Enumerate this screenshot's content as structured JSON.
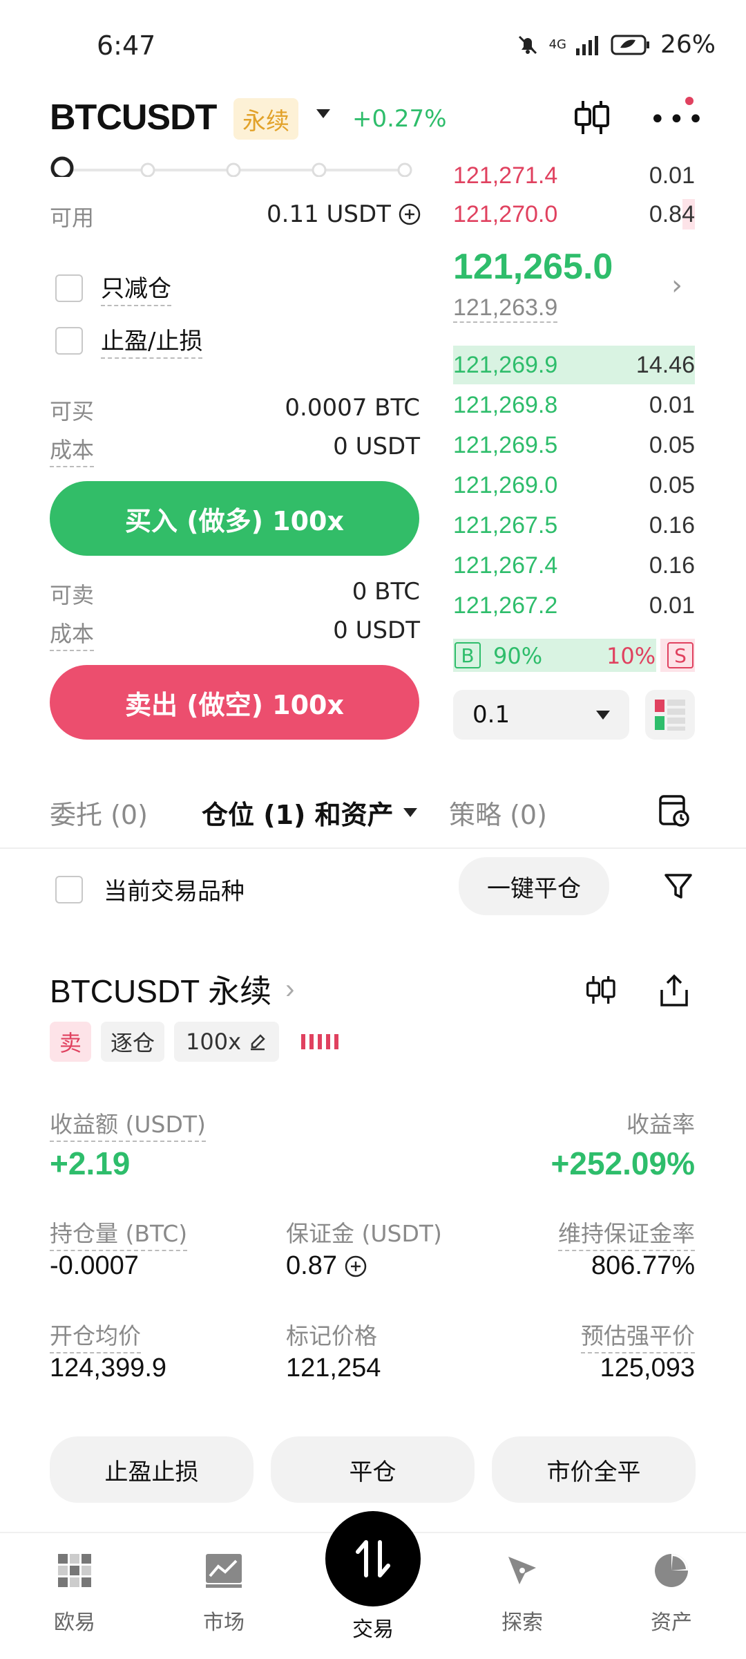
{
  "status": {
    "time": "6:47",
    "battery": "26%",
    "signal": "4G"
  },
  "header": {
    "symbol": "BTCUSDT",
    "badge": "永续",
    "change": "+0.27%"
  },
  "left": {
    "available_label": "可用",
    "available_value": "0.11 USDT",
    "reduce_only": "只减仓",
    "tp_sl": "止盈/止损",
    "can_buy_label": "可买",
    "can_buy_value": "0.0007 BTC",
    "cost_label_buy": "成本",
    "cost_value_buy": "0 USDT",
    "buy_button": "买入 (做多) 100x",
    "can_sell_label": "可卖",
    "can_sell_value": "0 BTC",
    "cost_label_sell": "成本",
    "cost_value_sell": "0 USDT",
    "sell_button": "卖出 (做空) 100x"
  },
  "orderbook": {
    "asks": [
      {
        "price": "121,271.4",
        "qty": "0.01"
      },
      {
        "price": "121,270.0",
        "qty": "0.84"
      }
    ],
    "mid_price": "121,265.0",
    "mark_price": "121,263.9",
    "bids": [
      {
        "price": "121,269.9",
        "qty": "14.46"
      },
      {
        "price": "121,269.8",
        "qty": "0.01"
      },
      {
        "price": "121,269.5",
        "qty": "0.05"
      },
      {
        "price": "121,269.0",
        "qty": "0.05"
      },
      {
        "price": "121,267.5",
        "qty": "0.16"
      },
      {
        "price": "121,267.4",
        "qty": "0.16"
      },
      {
        "price": "121,267.2",
        "qty": "0.01"
      }
    ],
    "buy_label": "B",
    "buy_ratio": "90%",
    "sell_ratio": "10%",
    "sell_label": "S",
    "depth": "0.1"
  },
  "tabs": {
    "orders": "委托 (0)",
    "positions": "仓位 (1) 和资产",
    "strategy": "策略 (0)"
  },
  "filter": {
    "current_symbol": "当前交易品种",
    "close_all": "一键平仓"
  },
  "position": {
    "title": "BTCUSDT 永续",
    "side": "卖",
    "margin_mode": "逐仓",
    "leverage": "100x",
    "pnl_label": "收益额 (USDT)",
    "pnl_value": "+2.19",
    "roi_label": "收益率",
    "roi_value": "+252.09%",
    "size_label": "持仓量 (BTC)",
    "size_value": "-0.0007",
    "margin_label": "保证金 (USDT)",
    "margin_value": "0.87",
    "mmr_label": "维持保证金率",
    "mmr_value": "806.77%",
    "entry_label": "开仓均价",
    "entry_value": "124,399.9",
    "mark_label": "标记价格",
    "mark_value": "121,254",
    "liq_label": "预估强平价",
    "liq_value": "125,093",
    "btn_tpsl": "止盈止损",
    "btn_close": "平仓",
    "btn_market_close": "市价全平"
  },
  "nav": {
    "home": "欧易",
    "markets": "市场",
    "trade": "交易",
    "discover": "探索",
    "assets": "资产"
  }
}
